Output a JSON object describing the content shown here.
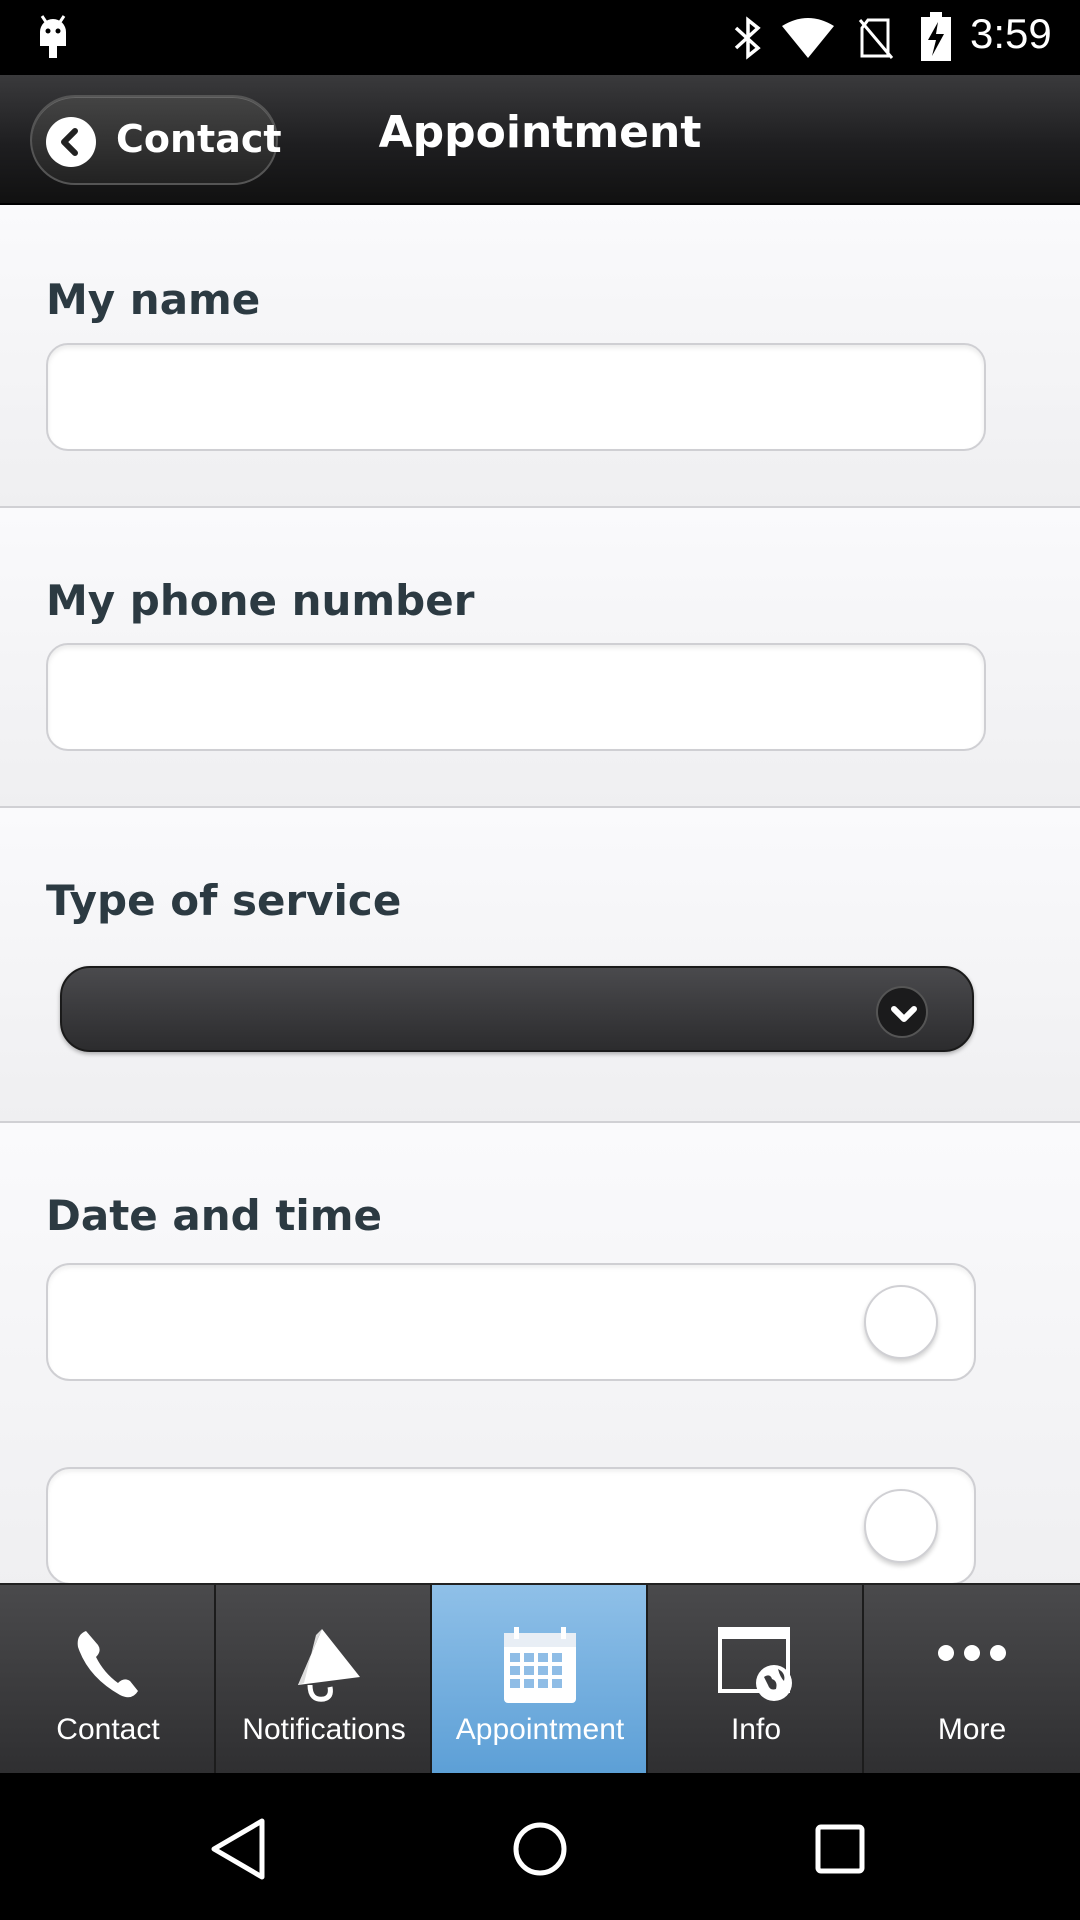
{
  "status_bar": {
    "time": "3:59",
    "icons": [
      "android-debug-icon",
      "bluetooth-icon",
      "wifi-icon",
      "no-sim-icon",
      "battery-charging-icon"
    ]
  },
  "header": {
    "back_label": "Contact",
    "title": "Appointment"
  },
  "form": {
    "name_label": "My name",
    "name_value": "",
    "phone_label": "My phone number",
    "phone_value": "",
    "service_label": "Type of service",
    "service_selected": "",
    "datetime_label": "Date and time",
    "date_value": "",
    "time_value": ""
  },
  "tabs": [
    {
      "label": "Contact",
      "icon": "phone-icon",
      "active": false
    },
    {
      "label": "Notifications",
      "icon": "megaphone-icon",
      "active": false
    },
    {
      "label": "Appointment",
      "icon": "calendar-icon",
      "active": true
    },
    {
      "label": "Info",
      "icon": "info-globe-icon",
      "active": false
    },
    {
      "label": "More",
      "icon": "more-dots-icon",
      "active": false
    }
  ],
  "colors": {
    "active_tab": "#6aa9dc",
    "label_text": "#2c3a42",
    "header_bg": "#1e1e20"
  }
}
